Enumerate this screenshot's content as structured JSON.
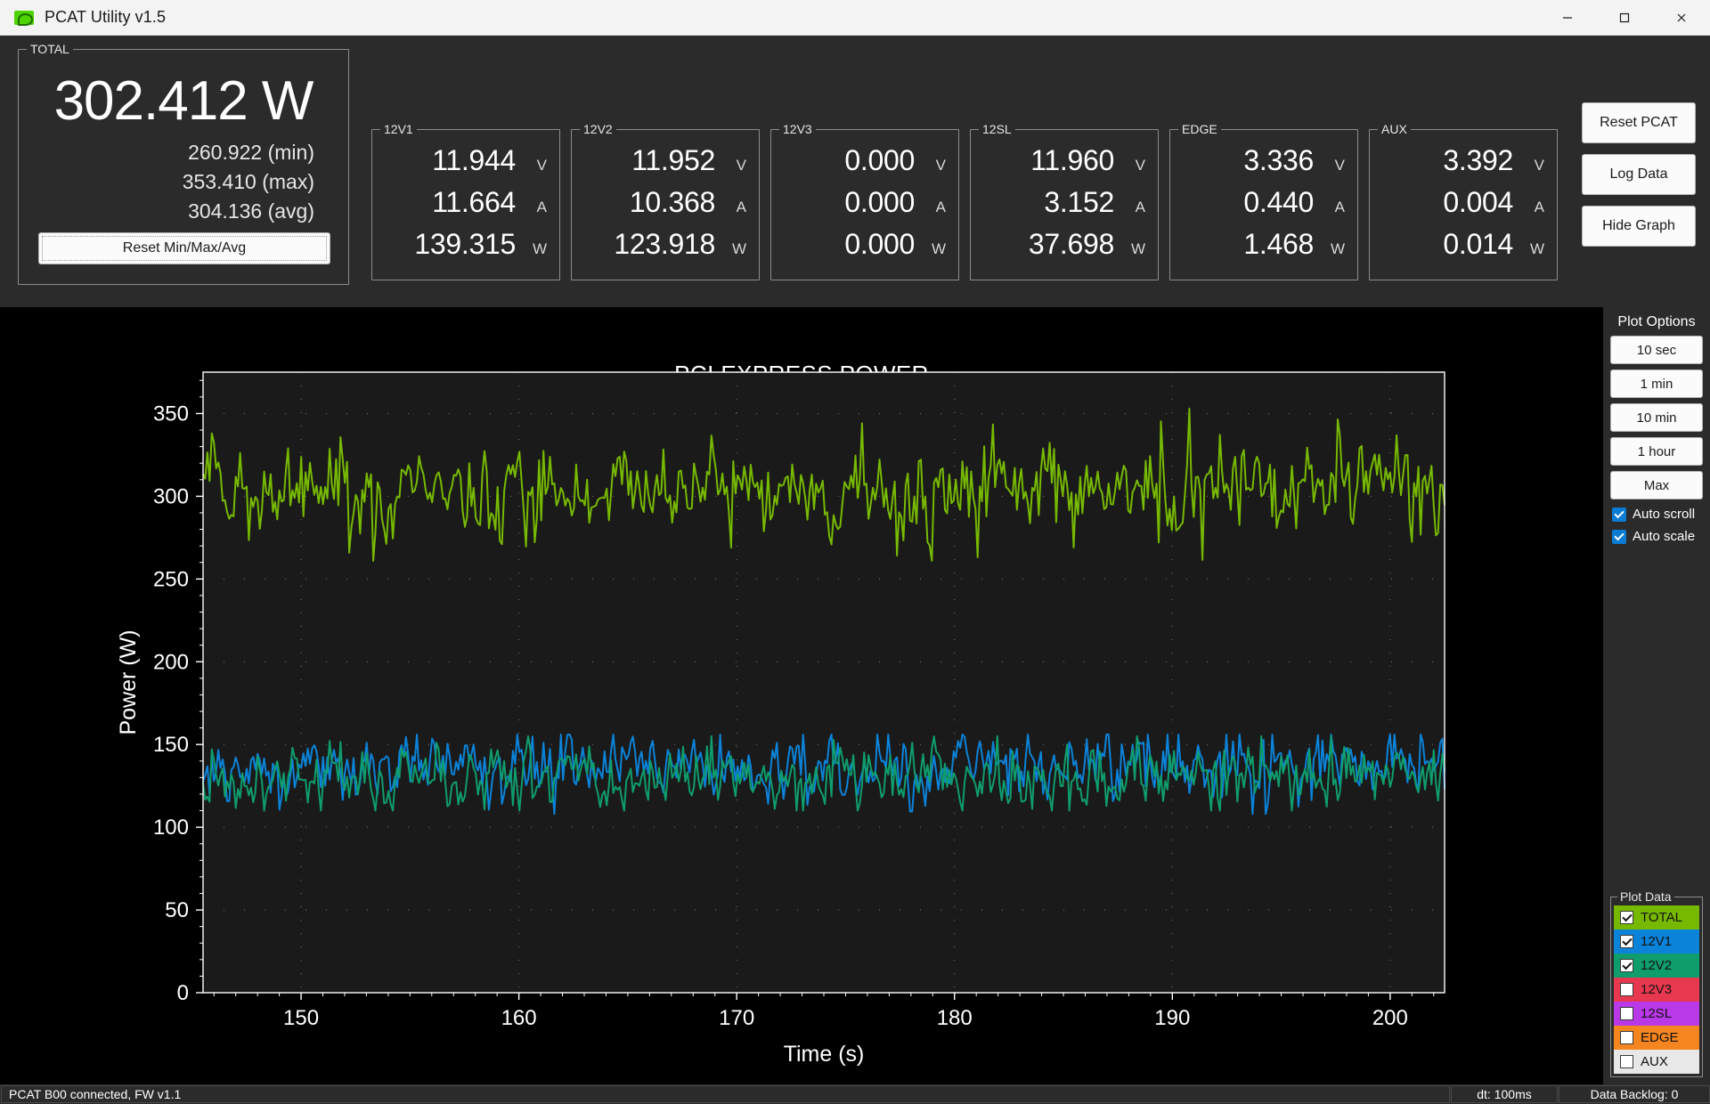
{
  "window": {
    "title": "PCAT Utility v1.5",
    "logo_icon": "nvidia-logo-icon",
    "controls": [
      {
        "name": "minimize",
        "icon": "minimize-icon"
      },
      {
        "name": "maximize",
        "icon": "maximize-icon"
      },
      {
        "name": "close",
        "icon": "close-icon"
      }
    ]
  },
  "total": {
    "legend": "TOTAL",
    "value": "302.412 W",
    "min": "260.922 (min)",
    "max": "353.410 (max)",
    "avg": "304.136 (avg)",
    "reset_label": "Reset Min/Max/Avg"
  },
  "rails": [
    {
      "legend": "12V1",
      "volts": "11.944",
      "amps": "11.664",
      "watts": "139.315"
    },
    {
      "legend": "12V2",
      "volts": "11.952",
      "amps": "10.368",
      "watts": "123.918"
    },
    {
      "legend": "12V3",
      "volts": "0.000",
      "amps": "0.000",
      "watts": "0.000"
    },
    {
      "legend": "12SL",
      "volts": "11.960",
      "amps": "3.152",
      "watts": "37.698"
    },
    {
      "legend": "EDGE",
      "volts": "3.336",
      "amps": "0.440",
      "watts": "1.468"
    },
    {
      "legend": "AUX",
      "volts": "3.392",
      "amps": "0.004",
      "watts": "0.014"
    }
  ],
  "rail_units": {
    "v": "V",
    "a": "A",
    "w": "W"
  },
  "actions": [
    {
      "label": "Reset PCAT",
      "name": "reset-pcat-button"
    },
    {
      "label": "Log Data",
      "name": "log-data-button"
    },
    {
      "label": "Hide Graph",
      "name": "hide-graph-button"
    }
  ],
  "plot_options": {
    "title": "Plot Options",
    "buttons": [
      {
        "label": "10 sec"
      },
      {
        "label": "1 min"
      },
      {
        "label": "10 min"
      },
      {
        "label": "1 hour"
      },
      {
        "label": "Max"
      }
    ],
    "checkboxes": [
      {
        "label": "Auto scroll",
        "checked": true
      },
      {
        "label": "Auto scale",
        "checked": true
      }
    ]
  },
  "plot_data": {
    "title": "Plot Data",
    "series": [
      {
        "label": "TOTAL",
        "checked": true,
        "color": "#76b900",
        "text_color": "#111111"
      },
      {
        "label": "12V1",
        "checked": true,
        "color": "#0b83d9",
        "text_color": "#111111"
      },
      {
        "label": "12V2",
        "checked": true,
        "color": "#0f9d6c",
        "text_color": "#111111"
      },
      {
        "label": "12V3",
        "checked": false,
        "color": "#e8384f",
        "text_color": "#111111"
      },
      {
        "label": "12SL",
        "checked": false,
        "color": "#b938e8",
        "text_color": "#111111"
      },
      {
        "label": "EDGE",
        "checked": false,
        "color": "#f5851f",
        "text_color": "#111111"
      },
      {
        "label": "AUX",
        "checked": false,
        "color": "#e8e8e8",
        "text_color": "#111111"
      }
    ]
  },
  "statusbar": {
    "connection": "PCAT B00 connected, FW v1.1",
    "dt": "dt: 100ms",
    "backlog": "Data Backlog: 0"
  },
  "chart_data": {
    "type": "line",
    "title": "PCI EXPRESS POWER",
    "xlabel": "Time (s)",
    "ylabel": "Power (W)",
    "xlim": [
      145.5,
      202.5
    ],
    "ylim": [
      0,
      375
    ],
    "xticks": [
      150,
      160,
      170,
      180,
      190,
      200
    ],
    "yticks": [
      0,
      50,
      100,
      150,
      200,
      250,
      300,
      350
    ],
    "grid": "dotted-minor",
    "legend_position": "external-bottom-right",
    "background": "#1a1a1a",
    "series": [
      {
        "name": "TOTAL",
        "color": "#76b900",
        "visible": true,
        "mean": 303,
        "min": 261,
        "max": 353,
        "noise_sd": 14
      },
      {
        "name": "12V1",
        "color": "#0b83d9",
        "visible": true,
        "mean": 137,
        "min": 108,
        "max": 156,
        "noise_sd": 9
      },
      {
        "name": "12V2",
        "color": "#0f9d6c",
        "visible": true,
        "mean": 130,
        "min": 110,
        "max": 155,
        "noise_sd": 9
      }
    ]
  }
}
